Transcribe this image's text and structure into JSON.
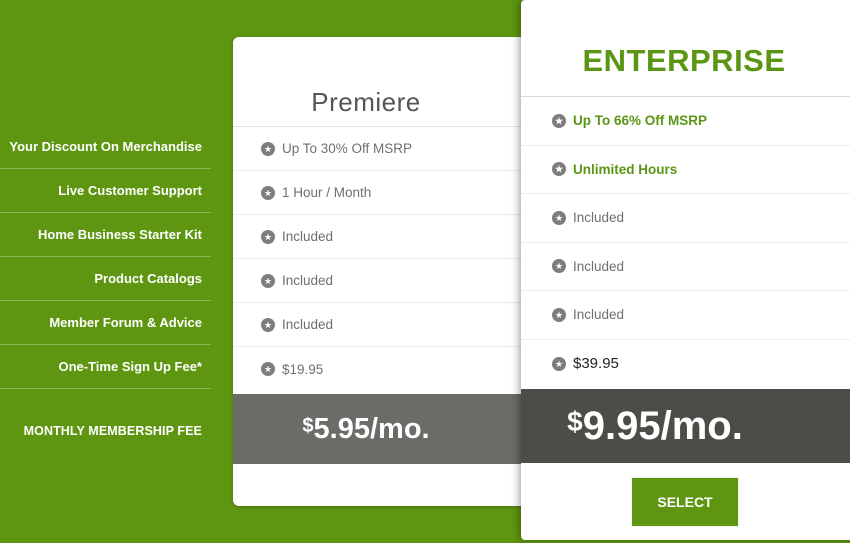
{
  "labels": [
    "Your Discount On Merchandise",
    "Live Customer Support",
    "Home Business Starter Kit",
    "Product Catalogs",
    "Member Forum & Advice",
    "One-Time Sign Up Fee*",
    "MONTHLY MEMBERSHIP FEE"
  ],
  "premiere": {
    "name": "Premiere",
    "features": [
      "Up To 30% Off MSRP",
      "1 Hour / Month",
      "Included",
      "Included",
      "Included",
      "$19.95"
    ],
    "price_currency": "$",
    "price_amount": "5.95/mo."
  },
  "enterprise": {
    "name": "ENTERPRISE",
    "features": [
      "Up To 66% Off MSRP",
      "Unlimited Hours",
      "Included",
      "Included",
      "Included",
      "$39.95"
    ],
    "price_currency": "$",
    "price_amount": "9.95/mo.",
    "select_label": "SELECT"
  },
  "icons": {
    "feature_bullet": "star-icon"
  },
  "colors": {
    "background": "#5f9611",
    "accent": "#5a9614",
    "price_band_dark": "#4d4d48",
    "price_band": "#6b6b67"
  }
}
